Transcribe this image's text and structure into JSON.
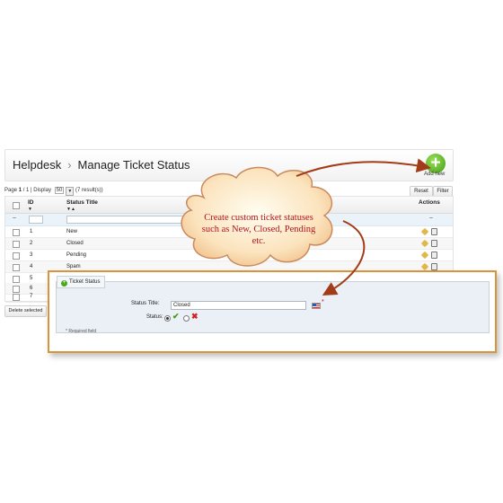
{
  "header": {
    "app": "Helpdesk",
    "separator": "›",
    "title": "Manage Ticket Status",
    "add_new_label": "Add new"
  },
  "pager": {
    "text_page": "Page",
    "current_page": "1",
    "of_text": "/ 1 | Display",
    "display_count": "50",
    "results": "(7 result(s))",
    "reset_label": "Reset",
    "filter_label": "Filter"
  },
  "grid": {
    "columns": {
      "id": "ID",
      "title": "Status Title",
      "actions": "Actions"
    },
    "filter_dash": "--",
    "actions_dash": "--",
    "rows": [
      {
        "id": "1",
        "title": "New"
      },
      {
        "id": "2",
        "title": "Closed"
      },
      {
        "id": "3",
        "title": "Pending"
      },
      {
        "id": "4",
        "title": "Spam"
      },
      {
        "id": "5",
        "title": ""
      },
      {
        "id": "6",
        "title": ""
      },
      {
        "id": "7",
        "title": ""
      }
    ],
    "delete_selected_label": "Delete selected"
  },
  "form": {
    "legend": "Ticket Status",
    "title_label": "Status Title:",
    "title_value": "Closed",
    "status_label": "Status:",
    "required_note": "* Required field"
  },
  "callout": {
    "text": "Create custom ticket statuses such as New, Closed, Pending etc."
  },
  "colors": {
    "accent_orange": "#d9933a",
    "callout_text": "#b4141b",
    "add_green": "#3e9b10"
  }
}
